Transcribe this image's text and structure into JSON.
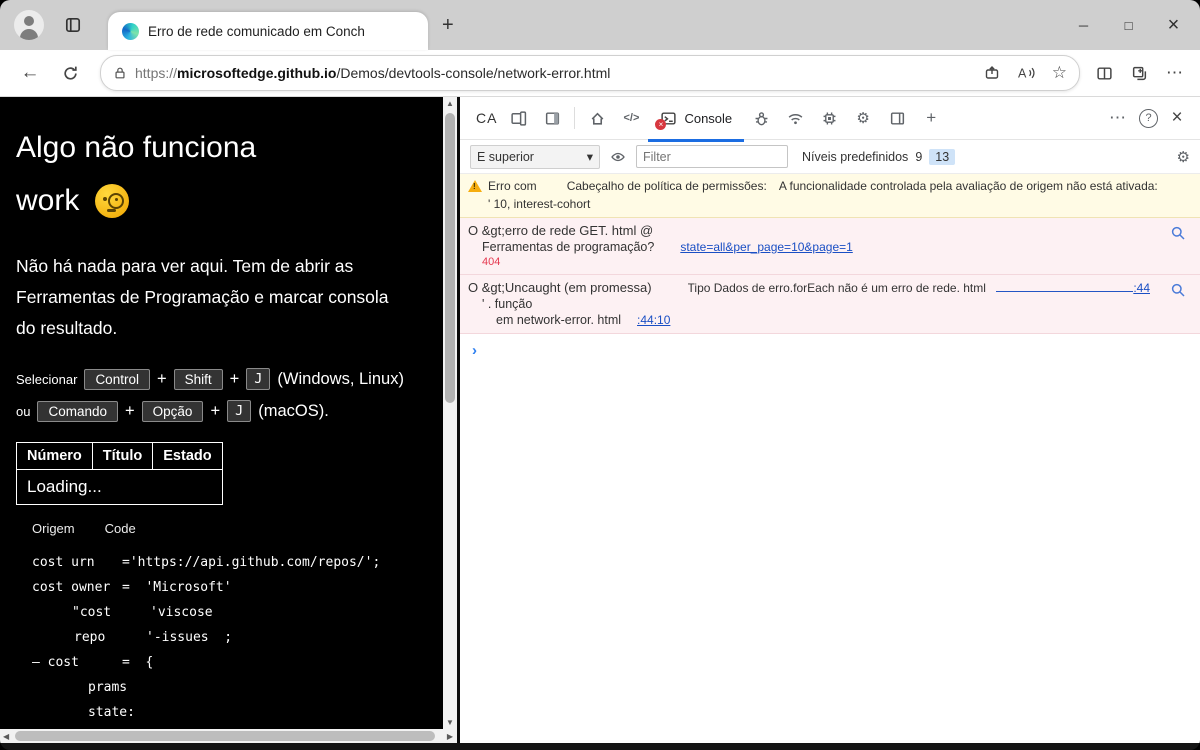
{
  "icons": {
    "minimize": "─",
    "maximize": "□",
    "close": "×",
    "back": "←",
    "more": "⋯",
    "star": "☆",
    "plus": "+",
    "chevron_down": "▾",
    "sources": "</>",
    "help": "?",
    "gear": "⚙",
    "prompt": "›",
    "scroll_up": "▲",
    "scroll_down": "▼",
    "scroll_left": "◀",
    "scroll_right": "▶",
    "warning_mark": "!",
    "read_aloud": "A"
  },
  "chrome": {
    "tab_title": "Erro de rede comunicado em Conch",
    "url": {
      "scheme": "https://",
      "domain": "microsoftedge.github.io",
      "path": "/Demos/devtools-console/network-error.html"
    }
  },
  "page": {
    "heading_line1": "Algo não funciona",
    "heading_line2": "work",
    "intro_line1": "Não há nada para ver aqui. Tem de abrir as",
    "intro_line2": "Ferramentas de Programação e marcar consola",
    "intro_line3": "do resultado.",
    "shortcut_win": {
      "prefix": "Selecionar",
      "key1": "Control",
      "plus": "+",
      "key2": "Shift",
      "key3": "J",
      "suffix": "(Windows, Linux)"
    },
    "shortcut_mac": {
      "prefix": "ou",
      "key1": "Comando",
      "plus": "+",
      "key2": "Opção",
      "key3": "J",
      "suffix": "(macOS)."
    },
    "table": {
      "col1": "Número",
      "col2": "Título",
      "col3": "Estado",
      "loading": "Loading..."
    },
    "code_tabs": {
      "tab1": "Origem",
      "tab2": "Code"
    },
    "code_lines": [
      {
        "a": "cost urn",
        "b": "='https://api.github.com/repos/';"
      },
      {
        "a": "cost owner",
        "b": "=  'Microsoft'"
      },
      {
        "a": "\"cost",
        "b": "'viscose"
      },
      {
        "a": "repo",
        "b": "'-issues  ;"
      },
      {
        "a": "– cost",
        "b": "=  {"
      },
      {
        "a": "prams",
        "b": ""
      },
      {
        "a": "state:",
        "b": ""
      }
    ]
  },
  "devtools": {
    "activity_label": "CA",
    "console_tab": "Console",
    "toolbar": {
      "context": "E superior",
      "filter_placeholder": "Filter",
      "levels_label": "Níveis predefinidos",
      "count_errors": "9",
      "count_warnings": "13"
    },
    "warning": {
      "part1": "Erro com",
      "part2": "Cabeçalho de política de permissões:",
      "part3": "A funcionalidade controlada pela avaliação de origem não está ativada:",
      "line2": "' 10, interest-cohort"
    },
    "error1": {
      "line1": "O &gt;erro de rede GET. html @",
      "line2": "Ferramentas de programação?",
      "link": "state=all&per_page=10&page=1",
      "status": "404"
    },
    "error2": {
      "line1a": "O &gt;Uncaught (em promessa)",
      "line1b": "Tipo Dados de erro.forEach não é um erro de rede. html",
      "link1": ":44",
      "line2": "' . função",
      "line3": "em network-error. html",
      "link2": ":44:10"
    }
  }
}
